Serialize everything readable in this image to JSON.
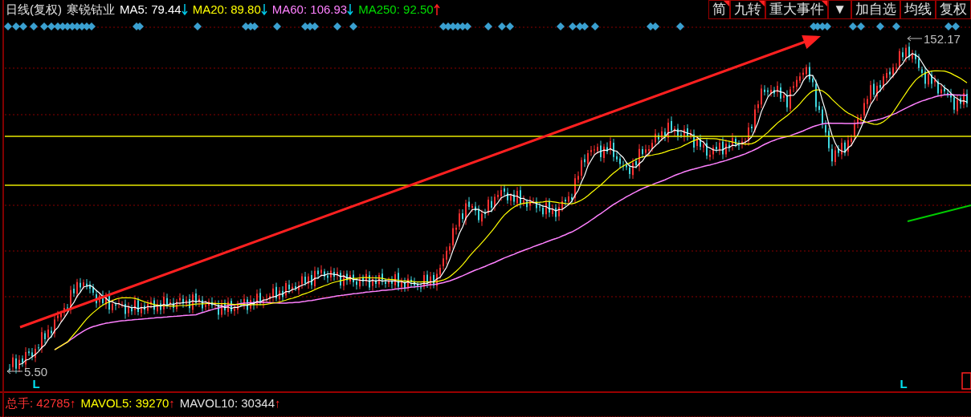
{
  "legend": [
    {
      "kind": "period",
      "text": "日线(复权)"
    },
    {
      "kind": "name",
      "text": "寒锐钴业"
    },
    {
      "kind": "ma",
      "label": "MA5:",
      "value": "79.44",
      "rising": false,
      "color": "#ffffff"
    },
    {
      "kind": "ma",
      "label": "MA20:",
      "value": "89.80",
      "rising": false,
      "color": "#ffff00"
    },
    {
      "kind": "ma",
      "label": "MA60:",
      "value": "106.93",
      "rising": false,
      "color": "#ff80ff"
    },
    {
      "kind": "ma",
      "label": "MA250:",
      "value": "92.50",
      "rising": true,
      "color": "#00dd00"
    }
  ],
  "toolbar": [
    {
      "kind": "button",
      "label": "简",
      "flagged": true
    },
    {
      "kind": "button",
      "label": "九转",
      "flagged": true
    },
    {
      "kind": "button",
      "label": "重大事件",
      "flagged": true
    },
    {
      "kind": "dropdown",
      "label": "▼",
      "flagged": false
    },
    {
      "kind": "button",
      "label": "加自选",
      "flagged": false
    },
    {
      "kind": "button",
      "label": "均线",
      "flagged": false
    },
    {
      "kind": "button",
      "label": "复权",
      "flagged": false
    }
  ],
  "chart": {
    "high_label": "152.17",
    "low_label": "5.50",
    "low_markers": [
      "L",
      "L"
    ]
  },
  "volume_legend": [
    {
      "label": "总手:",
      "value": "42785",
      "arrow": "↑",
      "color": "#ff3333"
    },
    {
      "label": "MAVOL5:",
      "value": "39270",
      "arrow": "↑",
      "color": "#ffff00"
    },
    {
      "label": "MAVOL10:",
      "value": "30344",
      "arrow": "↑",
      "color": "#e0e0e0"
    }
  ]
}
